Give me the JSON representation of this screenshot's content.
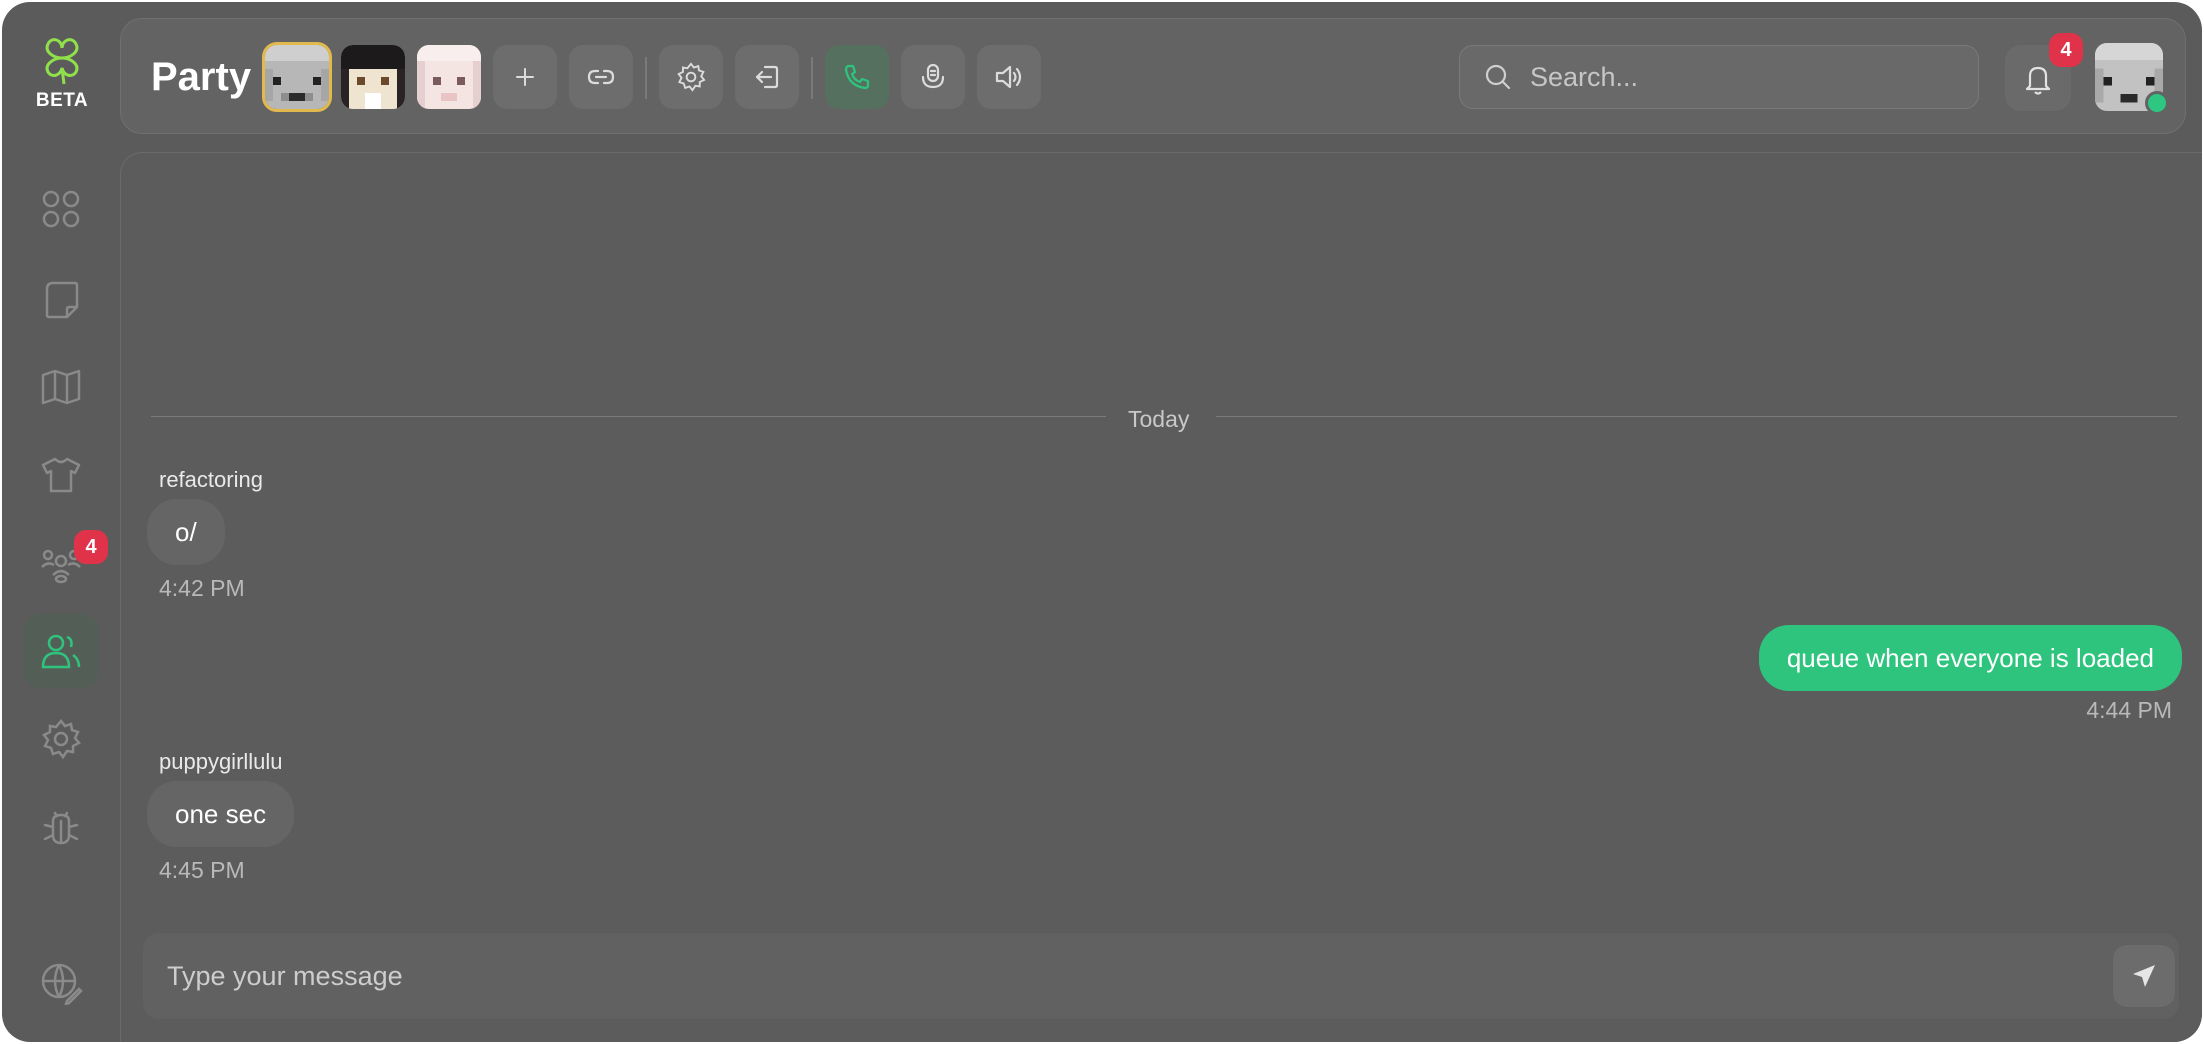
{
  "app": {
    "badge_label": "BETA",
    "accent_color": "#2ec47e",
    "badge_color": "#e0334a"
  },
  "sidebar": {
    "items": [
      {
        "name": "dashboard",
        "icon": "grid-icon"
      },
      {
        "name": "notes",
        "icon": "note-icon"
      },
      {
        "name": "map",
        "icon": "map-icon"
      },
      {
        "name": "wardrobe",
        "icon": "shirt-icon"
      },
      {
        "name": "community",
        "icon": "group-icon",
        "badge": "4"
      },
      {
        "name": "party",
        "icon": "users-icon",
        "active": true
      },
      {
        "name": "settings",
        "icon": "gear-icon"
      },
      {
        "name": "bug-report",
        "icon": "bug-icon"
      }
    ],
    "footer_icon": "globe-edit-icon"
  },
  "header": {
    "title": "Party",
    "members": [
      "host",
      "member-2",
      "member-3"
    ],
    "search_placeholder": "Search...",
    "notification_count": "4"
  },
  "chat": {
    "date_divider": "Today",
    "messages": [
      {
        "author": "refactoring",
        "text": "o/",
        "time": "4:42 PM",
        "outgoing": false
      },
      {
        "author": "",
        "text": "queue when everyone is loaded",
        "time": "4:44 PM",
        "outgoing": true
      },
      {
        "author": "puppygirllulu",
        "text": "one sec",
        "time": "4:45 PM",
        "outgoing": false
      }
    ],
    "composer_placeholder": "Type your message"
  }
}
